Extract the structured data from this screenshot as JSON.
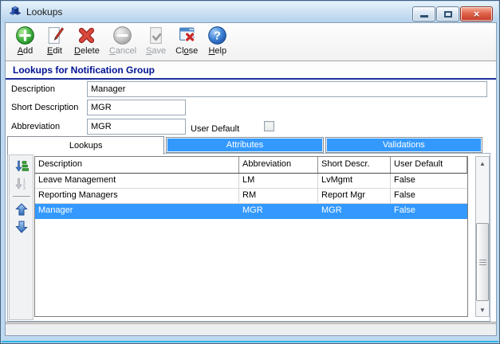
{
  "window": {
    "title": "Lookups",
    "icon": "cubes-icon"
  },
  "toolbar": {
    "buttons": [
      {
        "id": "add",
        "pre": "",
        "u": "A",
        "post": "dd",
        "enabled": true,
        "icon": "add-icon"
      },
      {
        "id": "edit",
        "pre": "",
        "u": "E",
        "post": "dit",
        "enabled": true,
        "icon": "edit-icon"
      },
      {
        "id": "delete",
        "pre": "",
        "u": "D",
        "post": "elete",
        "enabled": true,
        "icon": "delete-icon"
      },
      {
        "id": "cancel",
        "pre": "",
        "u": "C",
        "post": "ancel",
        "enabled": false,
        "icon": "cancel-icon"
      },
      {
        "id": "save",
        "pre": "",
        "u": "S",
        "post": "ave",
        "enabled": false,
        "icon": "save-icon"
      },
      {
        "id": "close",
        "pre": "Cl",
        "u": "o",
        "post": "se",
        "enabled": true,
        "icon": "close-window-icon"
      },
      {
        "id": "help",
        "pre": "",
        "u": "H",
        "post": "elp",
        "enabled": true,
        "icon": "help-icon"
      }
    ]
  },
  "section": {
    "title": "Lookups for Notification Group"
  },
  "form": {
    "description": {
      "label": "Description",
      "value": "Manager"
    },
    "short_description": {
      "label": "Short Description",
      "value": "MGR"
    },
    "abbreviation": {
      "label": "Abbreviation",
      "value": "MGR"
    },
    "user_default": {
      "label": "User Default",
      "checked": false
    }
  },
  "tabs": [
    {
      "label": "Lookups",
      "active": true
    },
    {
      "label": "Attributes",
      "active": false
    },
    {
      "label": "Validations",
      "active": false
    }
  ],
  "grid": {
    "columns": [
      "Description",
      "Abbreviation",
      "Short Descr.",
      "User Default"
    ],
    "rows": [
      [
        "Leave Management",
        "LM",
        "LvMgmt",
        "False"
      ],
      [
        "Reporting Managers",
        "RM",
        "Report Mgr",
        "False"
      ],
      [
        "Manager",
        "MGR",
        "MGR",
        "False"
      ]
    ],
    "selected_row_index": 2
  },
  "side_toolbar": {
    "buttons": [
      "sort-ascending-icon",
      "sort-numeric-icon",
      "move-up-icon",
      "move-down-icon"
    ]
  },
  "status": {
    "text": ""
  },
  "colors": {
    "selection_blue": "#3399ff",
    "tab_blue": "#3399ff",
    "header_navy": "#001294",
    "titlebar_blue": "#bed8f0"
  }
}
